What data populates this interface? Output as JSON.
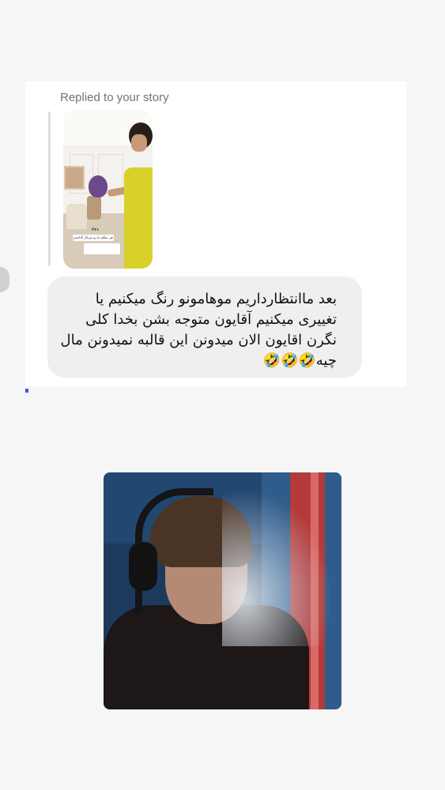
{
  "reply": {
    "label": "Replied to your story"
  },
  "story": {
    "counter": "۲۶۱",
    "caption": "فقط من که هی میگم ما رو سرکار گذاشتی 😂😂😂"
  },
  "message": {
    "text": "بعد ماانتظارداریم موهامونو رنگ میکنیم یا\nتغییری میکنیم آقایون متوجه بشن بخدا کلی\nنگرن اقایون الان میدونن این قالبه نمیدونن مال\nچیه🤣🤣🤣"
  },
  "colors": {
    "background": "#f6f6f6",
    "card": "#ffffff",
    "bubble": "#efefef",
    "label": "#737373"
  }
}
